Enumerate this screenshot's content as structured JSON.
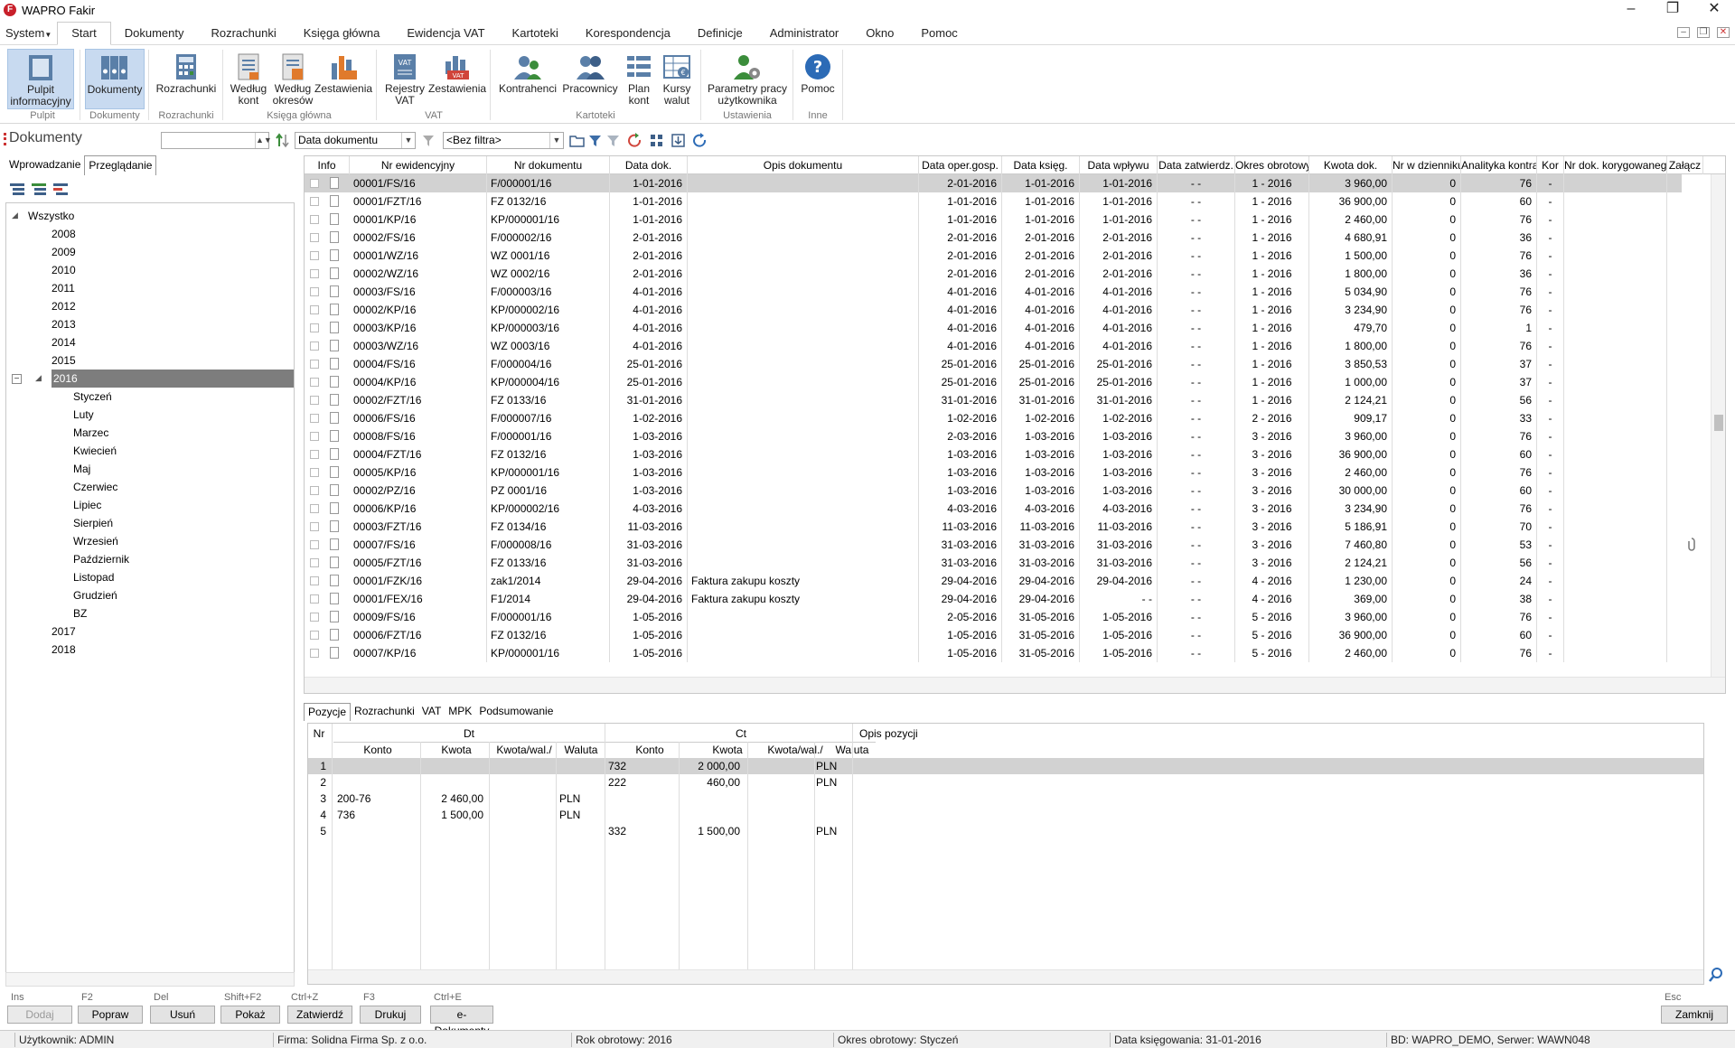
{
  "app": {
    "title": "WAPRO Fakir"
  },
  "menu": {
    "items": [
      "System",
      "Start",
      "Dokumenty",
      "Rozrachunki",
      "Księga główna",
      "Ewidencja VAT",
      "Kartoteki",
      "Korespondencja",
      "Definicje",
      "Administrator",
      "Okno",
      "Pomoc"
    ],
    "active": "Start"
  },
  "ribbon": {
    "buttons": [
      {
        "label1": "Pulpit",
        "label2": "informacyjny",
        "icon": "dashboard-icon",
        "active": true
      },
      {
        "label1": "Dokumenty",
        "label2": "",
        "icon": "documents-icon",
        "active": true
      },
      {
        "label1": "Rozrachunki",
        "label2": "",
        "icon": "calculator-icon"
      },
      {
        "label1": "Według",
        "label2": "kont",
        "icon": "ledger-icon"
      },
      {
        "label1": "Według",
        "label2": "okresów",
        "icon": "ledger-period-icon"
      },
      {
        "label1": "Zestawienia",
        "label2": "",
        "icon": "chart-kh-icon"
      },
      {
        "label1": "Rejestry",
        "label2": "VAT",
        "icon": "vat-register-icon"
      },
      {
        "label1": "Zestawienia",
        "label2": "",
        "icon": "vat-chart-icon"
      },
      {
        "label1": "Kontrahenci",
        "label2": "",
        "icon": "contractors-icon"
      },
      {
        "label1": "Pracownicy",
        "label2": "",
        "icon": "employees-icon"
      },
      {
        "label1": "Plan",
        "label2": "kont",
        "icon": "account-plan-icon"
      },
      {
        "label1": "Kursy",
        "label2": "walut",
        "icon": "currency-icon"
      },
      {
        "label1": "Parametry pracy",
        "label2": "użytkownika",
        "icon": "user-settings-icon"
      },
      {
        "label1": "Pomoc",
        "label2": "",
        "icon": "help-icon"
      }
    ],
    "groups": [
      "Pulpit",
      "Dokumenty",
      "Rozrachunki",
      "Księga główna",
      "VAT",
      "Kartoteki",
      "Ustawienia",
      "Inne"
    ]
  },
  "docbar": {
    "title": "Dokumenty",
    "sort_field": "Data dokumentu",
    "filter": "<Bez filtra>"
  },
  "left": {
    "tabs": [
      "Wprowadzanie",
      "Przeglądanie"
    ],
    "active_tab": "Przeglądanie",
    "tree_root": "Wszystko",
    "years_before": [
      "2008",
      "2009",
      "2010",
      "2011",
      "2012",
      "2013",
      "2014",
      "2015"
    ],
    "selected_year": "2016",
    "months": [
      "Styczeń",
      "Luty",
      "Marzec",
      "Kwiecień",
      "Maj",
      "Czerwiec",
      "Lipiec",
      "Sierpień",
      "Wrzesień",
      "Październik",
      "Listopad",
      "Grudzień",
      "BZ"
    ],
    "years_after": [
      "2017",
      "2018"
    ]
  },
  "grid": {
    "columns": [
      "Info",
      "Nr ewidencyjny",
      "Nr dokumentu",
      "Data dok.",
      "Opis dokumentu",
      "Data oper.gosp.",
      "Data księg.",
      "Data wpływu",
      "Data zatwierdz.",
      "Okres obrotowy",
      "Kwota dok.",
      "Nr w dzienniku",
      "Analityka kontra",
      "Kor",
      "Nr dok. korygowanego",
      "Załącz"
    ],
    "rows": [
      [
        "00001/FS/16",
        "F/000001/16",
        "1-01-2016",
        "",
        "2-01-2016",
        "1-01-2016",
        "1-01-2016",
        "- -",
        "1 - 2016",
        "3 960,00",
        "0",
        "76",
        "-"
      ],
      [
        "00001/FZT/16",
        "FZ 0132/16",
        "1-01-2016",
        "",
        "1-01-2016",
        "1-01-2016",
        "1-01-2016",
        "- -",
        "1 - 2016",
        "36 900,00",
        "0",
        "60",
        "-"
      ],
      [
        "00001/KP/16",
        "KP/000001/16",
        "1-01-2016",
        "",
        "1-01-2016",
        "1-01-2016",
        "1-01-2016",
        "- -",
        "1 - 2016",
        "2 460,00",
        "0",
        "76",
        "-"
      ],
      [
        "00002/FS/16",
        "F/000002/16",
        "2-01-2016",
        "",
        "2-01-2016",
        "2-01-2016",
        "2-01-2016",
        "- -",
        "1 - 2016",
        "4 680,91",
        "0",
        "36",
        "-"
      ],
      [
        "00001/WZ/16",
        "WZ 0001/16",
        "2-01-2016",
        "",
        "2-01-2016",
        "2-01-2016",
        "2-01-2016",
        "- -",
        "1 - 2016",
        "1 500,00",
        "0",
        "76",
        "-"
      ],
      [
        "00002/WZ/16",
        "WZ 0002/16",
        "2-01-2016",
        "",
        "2-01-2016",
        "2-01-2016",
        "2-01-2016",
        "- -",
        "1 - 2016",
        "1 800,00",
        "0",
        "36",
        "-"
      ],
      [
        "00003/FS/16",
        "F/000003/16",
        "4-01-2016",
        "",
        "4-01-2016",
        "4-01-2016",
        "4-01-2016",
        "- -",
        "1 - 2016",
        "5 034,90",
        "0",
        "76",
        "-"
      ],
      [
        "00002/KP/16",
        "KP/000002/16",
        "4-01-2016",
        "",
        "4-01-2016",
        "4-01-2016",
        "4-01-2016",
        "- -",
        "1 - 2016",
        "3 234,90",
        "0",
        "76",
        "-"
      ],
      [
        "00003/KP/16",
        "KP/000003/16",
        "4-01-2016",
        "",
        "4-01-2016",
        "4-01-2016",
        "4-01-2016",
        "- -",
        "1 - 2016",
        "479,70",
        "0",
        "1",
        "-"
      ],
      [
        "00003/WZ/16",
        "WZ 0003/16",
        "4-01-2016",
        "",
        "4-01-2016",
        "4-01-2016",
        "4-01-2016",
        "- -",
        "1 - 2016",
        "1 800,00",
        "0",
        "76",
        "-"
      ],
      [
        "00004/FS/16",
        "F/000004/16",
        "25-01-2016",
        "",
        "25-01-2016",
        "25-01-2016",
        "25-01-2016",
        "- -",
        "1 - 2016",
        "3 850,53",
        "0",
        "37",
        "-"
      ],
      [
        "00004/KP/16",
        "KP/000004/16",
        "25-01-2016",
        "",
        "25-01-2016",
        "25-01-2016",
        "25-01-2016",
        "- -",
        "1 - 2016",
        "1 000,00",
        "0",
        "37",
        "-"
      ],
      [
        "00002/FZT/16",
        "FZ 0133/16",
        "31-01-2016",
        "",
        "31-01-2016",
        "31-01-2016",
        "31-01-2016",
        "- -",
        "1 - 2016",
        "2 124,21",
        "0",
        "56",
        "-"
      ],
      [
        "00006/FS/16",
        "F/000007/16",
        "1-02-2016",
        "",
        "1-02-2016",
        "1-02-2016",
        "1-02-2016",
        "- -",
        "2 - 2016",
        "909,17",
        "0",
        "33",
        "-"
      ],
      [
        "00008/FS/16",
        "F/000001/16",
        "1-03-2016",
        "",
        "2-03-2016",
        "1-03-2016",
        "1-03-2016",
        "- -",
        "3 - 2016",
        "3 960,00",
        "0",
        "76",
        "-"
      ],
      [
        "00004/FZT/16",
        "FZ 0132/16",
        "1-03-2016",
        "",
        "1-03-2016",
        "1-03-2016",
        "1-03-2016",
        "- -",
        "3 - 2016",
        "36 900,00",
        "0",
        "60",
        "-"
      ],
      [
        "00005/KP/16",
        "KP/000001/16",
        "1-03-2016",
        "",
        "1-03-2016",
        "1-03-2016",
        "1-03-2016",
        "- -",
        "3 - 2016",
        "2 460,00",
        "0",
        "76",
        "-"
      ],
      [
        "00002/PZ/16",
        "PZ 0001/16",
        "1-03-2016",
        "",
        "1-03-2016",
        "1-03-2016",
        "1-03-2016",
        "- -",
        "3 - 2016",
        "30 000,00",
        "0",
        "60",
        "-"
      ],
      [
        "00006/KP/16",
        "KP/000002/16",
        "4-03-2016",
        "",
        "4-03-2016",
        "4-03-2016",
        "4-03-2016",
        "- -",
        "3 - 2016",
        "3 234,90",
        "0",
        "76",
        "-"
      ],
      [
        "00003/FZT/16",
        "FZ 0134/16",
        "11-03-2016",
        "",
        "11-03-2016",
        "11-03-2016",
        "11-03-2016",
        "- -",
        "3 - 2016",
        "5 186,91",
        "0",
        "70",
        "-"
      ],
      [
        "00007/FS/16",
        "F/000008/16",
        "31-03-2016",
        "",
        "31-03-2016",
        "31-03-2016",
        "31-03-2016",
        "- -",
        "3 - 2016",
        "7 460,80",
        "0",
        "53",
        "-"
      ],
      [
        "00005/FZT/16",
        "FZ 0133/16",
        "31-03-2016",
        "",
        "31-03-2016",
        "31-03-2016",
        "31-03-2016",
        "- -",
        "3 - 2016",
        "2 124,21",
        "0",
        "56",
        "-"
      ],
      [
        "00001/FZK/16",
        "zak1/2014",
        "29-04-2016",
        "Faktura zakupu koszty",
        "29-04-2016",
        "29-04-2016",
        "29-04-2016",
        "- -",
        "4 - 2016",
        "1 230,00",
        "0",
        "24",
        "-"
      ],
      [
        "00001/FEX/16",
        "F1/2014",
        "29-04-2016",
        "Faktura zakupu koszty",
        "29-04-2016",
        "29-04-2016",
        "- -",
        "- -",
        "4 - 2016",
        "369,00",
        "0",
        "38",
        "-"
      ],
      [
        "00009/FS/16",
        "F/000001/16",
        "1-05-2016",
        "",
        "2-05-2016",
        "31-05-2016",
        "1-05-2016",
        "- -",
        "5 - 2016",
        "3 960,00",
        "0",
        "76",
        "-"
      ],
      [
        "00006/FZT/16",
        "FZ 0132/16",
        "1-05-2016",
        "",
        "1-05-2016",
        "31-05-2016",
        "1-05-2016",
        "- -",
        "5 - 2016",
        "36 900,00",
        "0",
        "60",
        "-"
      ],
      [
        "00007/KP/16",
        "KP/000001/16",
        "1-05-2016",
        "",
        "1-05-2016",
        "31-05-2016",
        "1-05-2016",
        "- -",
        "5 - 2016",
        "2 460,00",
        "0",
        "76",
        "-"
      ]
    ]
  },
  "bottom": {
    "tabs": [
      "Pozycje",
      "Rozrachunki",
      "VAT",
      "MPK",
      "Podsumowanie"
    ],
    "active_tab": "Pozycje",
    "headers": {
      "nr": "Nr",
      "dt": "Dt",
      "ct": "Ct",
      "opis": "Opis pozycji",
      "konto": "Konto",
      "kwota": "Kwota",
      "kwota_wal": "Kwota/wal./",
      "waluta": "Waluta"
    },
    "rows": [
      [
        "1",
        "",
        "",
        "",
        "",
        "732",
        "2 000,00",
        "",
        "PLN"
      ],
      [
        "2",
        "",
        "",
        "",
        "",
        "222",
        "460,00",
        "",
        "PLN"
      ],
      [
        "3",
        "200-76",
        "2 460,00",
        "",
        "PLN",
        "",
        "",
        "",
        ""
      ],
      [
        "4",
        "736",
        "1 500,00",
        "",
        "PLN",
        "",
        "",
        "",
        ""
      ],
      [
        "5",
        "",
        "",
        "",
        "",
        "332",
        "1 500,00",
        "",
        "PLN"
      ]
    ]
  },
  "actions": [
    {
      "hotkey": "Ins",
      "label": "Dodaj",
      "disabled": true
    },
    {
      "hotkey": "F2",
      "label": "Popraw"
    },
    {
      "hotkey": "Del",
      "label": "Usuń"
    },
    {
      "hotkey": "Shift+F2",
      "label": "Pokaż"
    },
    {
      "hotkey": "Ctrl+Z",
      "label": "Zatwierdź"
    },
    {
      "hotkey": "F3",
      "label": "Drukuj"
    },
    {
      "hotkey": "Ctrl+E",
      "label": "e-Dokumenty"
    },
    {
      "hotkey": "Esc",
      "label": "Zamknij"
    }
  ],
  "status": {
    "user": "Użytkownik: ADMIN",
    "firm": "Firma: Solidna Firma Sp. z o.o.",
    "year": "Rok obrotowy: 2016",
    "period": "Okres obrotowy: Styczeń",
    "booking_date": "Data księgowania: 31-01-2016",
    "db": "BD: WAPRO_DEMO, Serwer: WAWN048"
  },
  "colors": {
    "accent": "#c8daf0",
    "selected_row": "#d2d2d2",
    "tree_selected": "#7d7d7d",
    "logo": "#c8202a"
  }
}
